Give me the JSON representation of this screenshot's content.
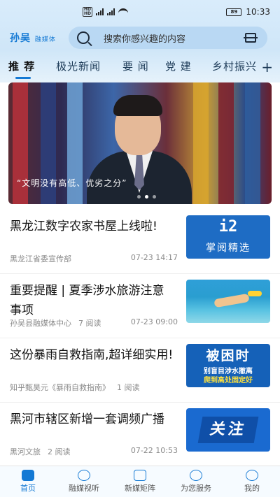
{
  "status": {
    "time": "10:33",
    "battery": "89"
  },
  "header": {
    "logo": "孙吴",
    "logo_sub": "融媒体",
    "search_placeholder": "搜索你感兴趣的内容"
  },
  "tabs": [
    {
      "label": "推 荐",
      "active": true
    },
    {
      "label": "极光新闻"
    },
    {
      "label": "要 闻"
    },
    {
      "label": "党 建"
    },
    {
      "label": "乡村振兴"
    }
  ],
  "banner": {
    "caption": "“文明没有高低、优劣之分”"
  },
  "news": [
    {
      "title": "黑龙江数字农家书屋上线啦!",
      "source": "黑龙江省委宣传部",
      "reads": "",
      "time": "07-23 14:17",
      "thumb_big": "i2",
      "thumb_small": "掌阅精选"
    },
    {
      "title": "重要提醒 | 夏季涉水旅游注意事项",
      "source": "孙吴县融媒体中心",
      "reads": "7 阅读",
      "time": "07-23 09:00"
    },
    {
      "title": "这份暴雨自救指南,超详细实用!",
      "source": "知乎甄昊元《暴雨自救指南》",
      "reads": "1 阅读",
      "time": "",
      "thumb_big": "被困时",
      "thumb_l1": "别盲目涉水撤离",
      "thumb_l2": "爬到高处固定好"
    },
    {
      "title": "黑河市辖区新增一套调频广播",
      "source": "黑河文旅",
      "reads": "2 阅读",
      "time": "07-22 10:53",
      "thumb_big": "关注"
    }
  ],
  "nav": [
    {
      "label": "首页",
      "active": true
    },
    {
      "label": "融媒视听"
    },
    {
      "label": "新媒矩阵"
    },
    {
      "label": "为您服务"
    },
    {
      "label": "我的"
    }
  ],
  "colors": {
    "accent": "#1479d4",
    "header_bg": "#d9ecfb"
  }
}
